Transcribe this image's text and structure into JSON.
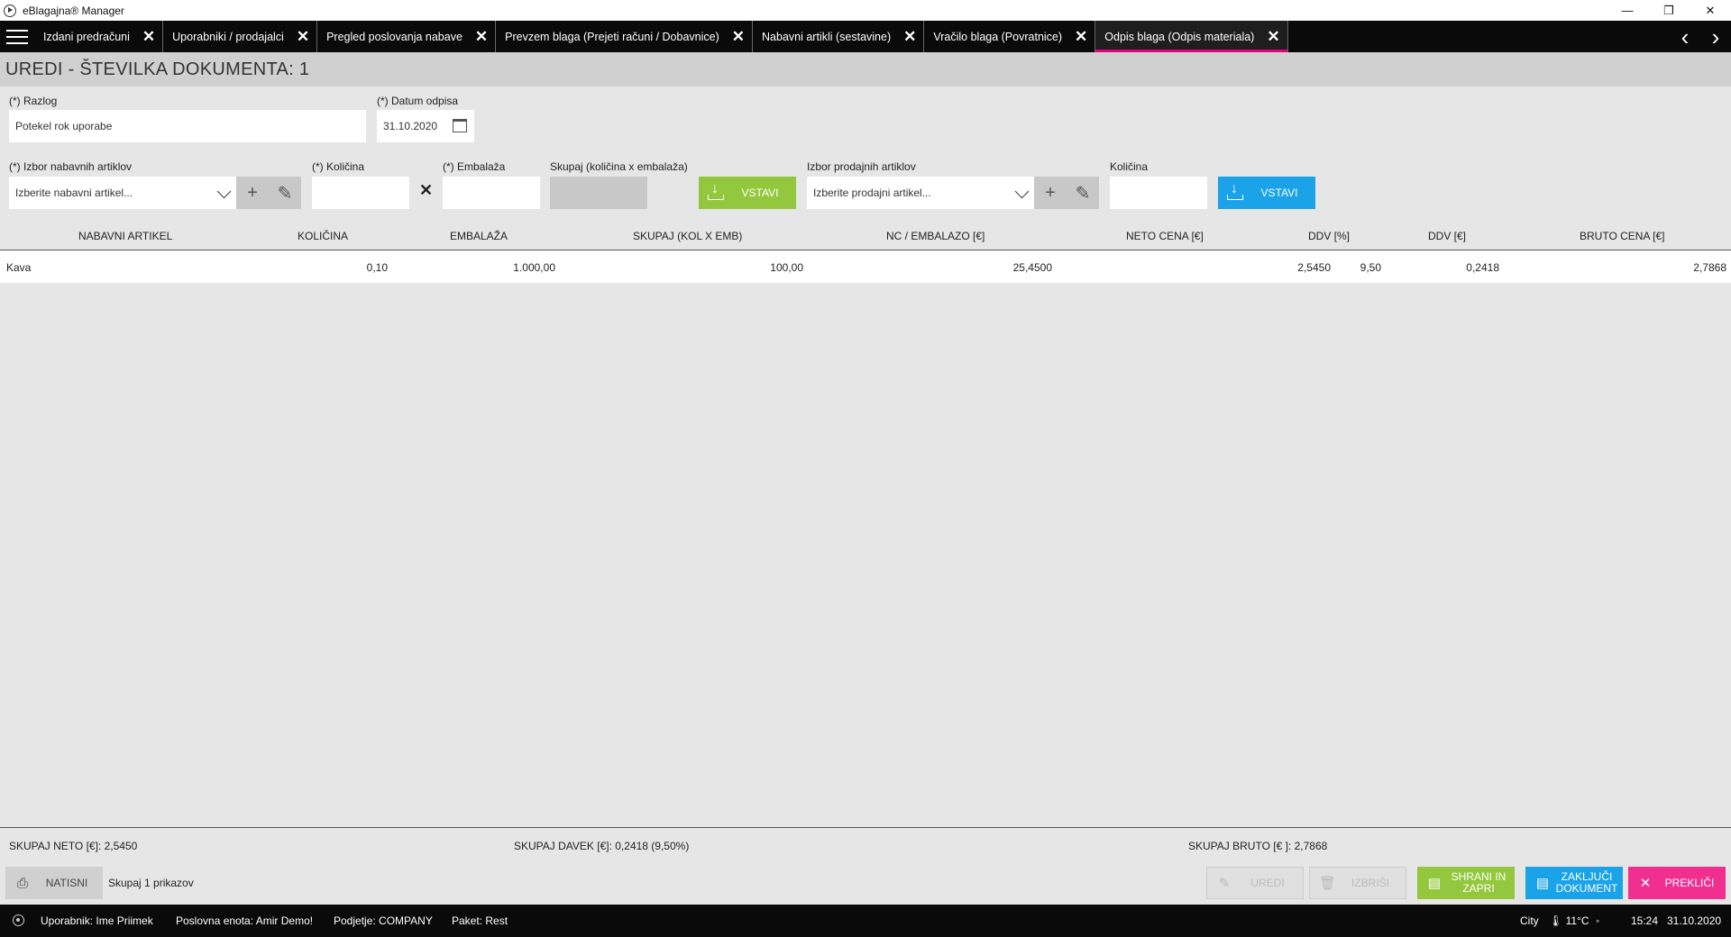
{
  "window": {
    "title": "eBlagajna® Manager",
    "minimize": "—",
    "restore": "❐",
    "close": "✕"
  },
  "tabs": [
    {
      "label": "Izdani predračuni"
    },
    {
      "label": "Uporabniki / prodajalci"
    },
    {
      "label": "Pregled poslovanja nabave"
    },
    {
      "label": "Prevzem blaga (Prejeti računi / Dobavnice)"
    },
    {
      "label": "Nabavni artikli (sestavine)"
    },
    {
      "label": "Vračilo blaga (Povratnice)"
    },
    {
      "label": "Odpis blaga (Odpis materiala)",
      "active": true
    }
  ],
  "page": {
    "title": "UREDI - ŠTEVILKA DOKUMENTA: 1"
  },
  "form": {
    "razlog_label": "(*) Razlog",
    "razlog_value": "Potekel rok uporabe",
    "datum_label": "(*) Datum odpisa",
    "datum_value": "31.10.2020",
    "nabavni_label": "(*) Izbor nabavnih artiklov",
    "nabavni_placeholder": "Izberite nabavni artikel...",
    "kolicina_label": "(*) Količina",
    "embalaza_label": "(*) Embalaža",
    "skupaj_label": "Skupaj (količina x embalaža)",
    "vstavi_label": "VSTAVI",
    "prodajni_label": "Izbor prodajnih artiklov",
    "prodajni_placeholder": "Izberite prodajni artikel...",
    "kolicina2_label": "Količina",
    "vstavi2_label": "VSTAVI"
  },
  "table": {
    "headers": [
      "NABAVNI ARTIKEL",
      "KOLIČINA",
      "EMBALAŽA",
      "SKUPAJ (KOL X EMB)",
      "NC / EMBALAZO [€]",
      "NETO CENA [€]",
      "DDV [%]",
      "DDV [€]",
      "BRUTO CENA [€]"
    ],
    "rows": [
      {
        "artikel": "Kava",
        "kolicina": "0,10",
        "embalaza": "1.000,00",
        "skupaj": "100,00",
        "nc": "25,4500",
        "neto": "2,5450",
        "ddv_pct": "9,50",
        "ddv": "0,2418",
        "bruto": "2,7868"
      }
    ]
  },
  "summary": {
    "neto": "SKUPAJ NETO [€]: 2,5450",
    "davek": "SKUPAJ DAVEK [€]: 0,2418 (9,50%)",
    "bruto": "SKUPAJ BRUTO [€ ]: 2,7868"
  },
  "actions": {
    "natisni": "NATISNI",
    "count": "Skupaj 1 prikazov",
    "uredi": "UREDI",
    "izbrisi": "IZBRIŠI",
    "shrani_line1": "SHRANI IN",
    "shrani_line2": "ZAPRI",
    "zakljuci_line1": "ZAKLJUČI",
    "zakljuci_line2": "DOKUMENT",
    "preklici": "PREKLIČI"
  },
  "status": {
    "user": "Uporabnik: Ime Priimek",
    "unit": "Poslovna enota: Amir Demo!",
    "company": "Podjetje: COMPANY",
    "package": "Paket: Rest",
    "city": "City",
    "temp": "🌡 11°C",
    "weather": "◦",
    "time": "15:24",
    "date": "31.10.2020"
  },
  "colors": {
    "accent_pink": "#e6007e",
    "green": "#93c83e",
    "blue": "#1aa3e8"
  }
}
